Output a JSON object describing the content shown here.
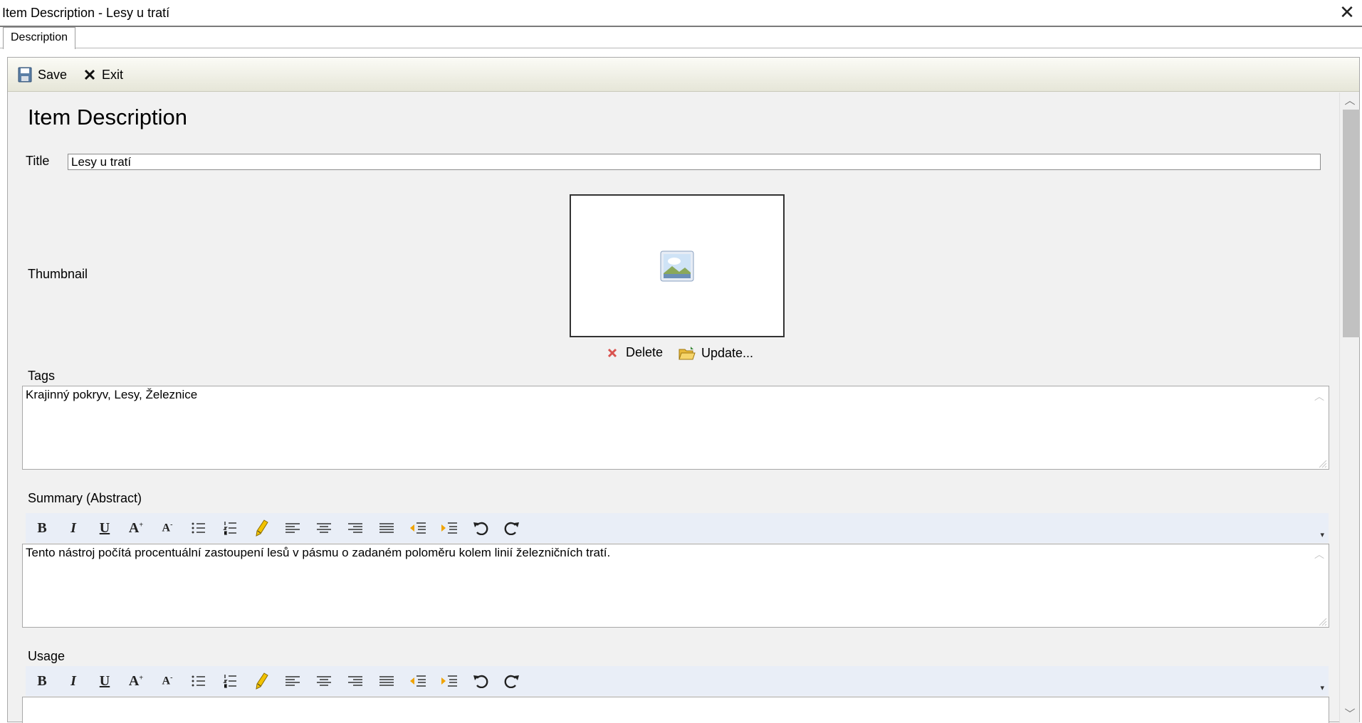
{
  "window": {
    "title": "Item Description - Lesy u tratí"
  },
  "tabs": [
    {
      "label": "Description"
    }
  ],
  "toolbar": {
    "save_label": "Save",
    "exit_label": "Exit"
  },
  "form": {
    "heading": "Item Description",
    "title_label": "Title",
    "title_value": "Lesy u tratí",
    "thumbnail_label": "Thumbnail",
    "delete_label": "Delete",
    "update_label": "Update...",
    "tags_label": "Tags",
    "tags_value": "Krajinný pokryv, Lesy, Železnice",
    "summary_label": "Summary (Abstract)",
    "summary_value": "Tento nástroj počítá procentuální zastoupení lesů v pásmu o zadaném poloměru kolem linií železničních tratí.",
    "usage_label": "Usage"
  },
  "richtext_buttons": [
    "bold",
    "italic",
    "underline",
    "font-grow",
    "font-shrink",
    "bullet-list",
    "numbered-list",
    "highlight",
    "align-left",
    "align-center",
    "align-right",
    "justify",
    "outdent",
    "indent",
    "undo",
    "redo"
  ],
  "colors": {
    "toolbar_bg": "#ecece0",
    "richtext_toolbar_bg": "#e9eef7",
    "panel_bg": "#f1f1f1"
  }
}
